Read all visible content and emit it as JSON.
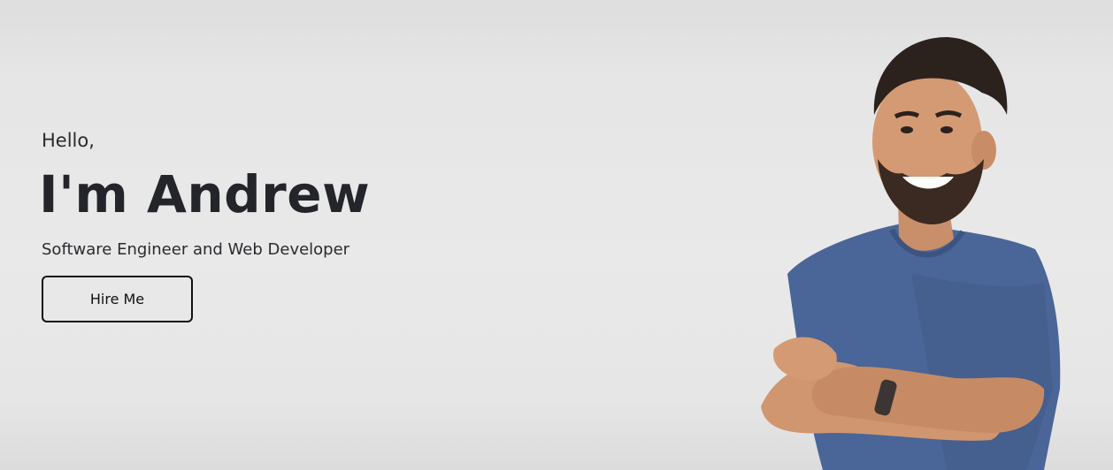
{
  "hero": {
    "greeting": "Hello,",
    "name": "I'm Andrew",
    "subtitle": "Software Engineer and Web Developer",
    "cta_label": "Hire Me"
  },
  "colors": {
    "background": "#e8e8e8",
    "text": "#23252a",
    "button_border": "#111111",
    "shirt": "#4a6597"
  },
  "portrait": {
    "icon": "person-photo"
  }
}
